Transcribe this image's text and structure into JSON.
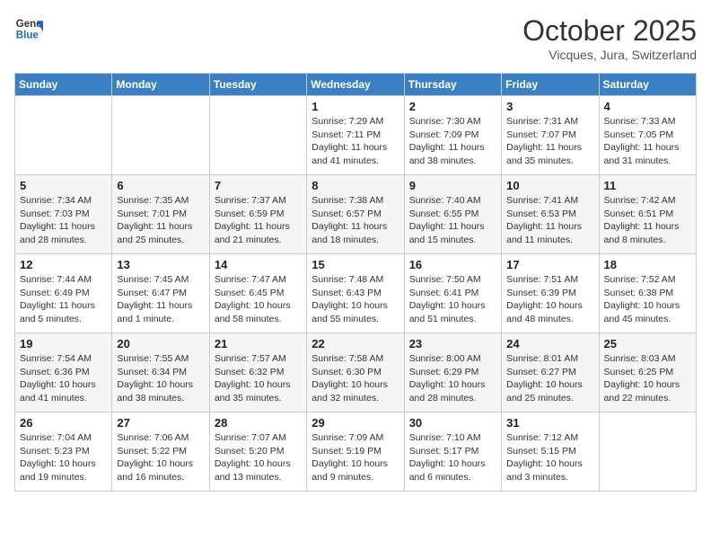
{
  "header": {
    "logo_line1": "General",
    "logo_line2": "Blue",
    "month": "October 2025",
    "location": "Vicques, Jura, Switzerland"
  },
  "weekdays": [
    "Sunday",
    "Monday",
    "Tuesday",
    "Wednesday",
    "Thursday",
    "Friday",
    "Saturday"
  ],
  "weeks": [
    [
      {
        "day": "",
        "info": ""
      },
      {
        "day": "",
        "info": ""
      },
      {
        "day": "",
        "info": ""
      },
      {
        "day": "1",
        "info": "Sunrise: 7:29 AM\nSunset: 7:11 PM\nDaylight: 11 hours\nand 41 minutes."
      },
      {
        "day": "2",
        "info": "Sunrise: 7:30 AM\nSunset: 7:09 PM\nDaylight: 11 hours\nand 38 minutes."
      },
      {
        "day": "3",
        "info": "Sunrise: 7:31 AM\nSunset: 7:07 PM\nDaylight: 11 hours\nand 35 minutes."
      },
      {
        "day": "4",
        "info": "Sunrise: 7:33 AM\nSunset: 7:05 PM\nDaylight: 11 hours\nand 31 minutes."
      }
    ],
    [
      {
        "day": "5",
        "info": "Sunrise: 7:34 AM\nSunset: 7:03 PM\nDaylight: 11 hours\nand 28 minutes."
      },
      {
        "day": "6",
        "info": "Sunrise: 7:35 AM\nSunset: 7:01 PM\nDaylight: 11 hours\nand 25 minutes."
      },
      {
        "day": "7",
        "info": "Sunrise: 7:37 AM\nSunset: 6:59 PM\nDaylight: 11 hours\nand 21 minutes."
      },
      {
        "day": "8",
        "info": "Sunrise: 7:38 AM\nSunset: 6:57 PM\nDaylight: 11 hours\nand 18 minutes."
      },
      {
        "day": "9",
        "info": "Sunrise: 7:40 AM\nSunset: 6:55 PM\nDaylight: 11 hours\nand 15 minutes."
      },
      {
        "day": "10",
        "info": "Sunrise: 7:41 AM\nSunset: 6:53 PM\nDaylight: 11 hours\nand 11 minutes."
      },
      {
        "day": "11",
        "info": "Sunrise: 7:42 AM\nSunset: 6:51 PM\nDaylight: 11 hours\nand 8 minutes."
      }
    ],
    [
      {
        "day": "12",
        "info": "Sunrise: 7:44 AM\nSunset: 6:49 PM\nDaylight: 11 hours\nand 5 minutes."
      },
      {
        "day": "13",
        "info": "Sunrise: 7:45 AM\nSunset: 6:47 PM\nDaylight: 11 hours\nand 1 minute."
      },
      {
        "day": "14",
        "info": "Sunrise: 7:47 AM\nSunset: 6:45 PM\nDaylight: 10 hours\nand 58 minutes."
      },
      {
        "day": "15",
        "info": "Sunrise: 7:48 AM\nSunset: 6:43 PM\nDaylight: 10 hours\nand 55 minutes."
      },
      {
        "day": "16",
        "info": "Sunrise: 7:50 AM\nSunset: 6:41 PM\nDaylight: 10 hours\nand 51 minutes."
      },
      {
        "day": "17",
        "info": "Sunrise: 7:51 AM\nSunset: 6:39 PM\nDaylight: 10 hours\nand 48 minutes."
      },
      {
        "day": "18",
        "info": "Sunrise: 7:52 AM\nSunset: 6:38 PM\nDaylight: 10 hours\nand 45 minutes."
      }
    ],
    [
      {
        "day": "19",
        "info": "Sunrise: 7:54 AM\nSunset: 6:36 PM\nDaylight: 10 hours\nand 41 minutes."
      },
      {
        "day": "20",
        "info": "Sunrise: 7:55 AM\nSunset: 6:34 PM\nDaylight: 10 hours\nand 38 minutes."
      },
      {
        "day": "21",
        "info": "Sunrise: 7:57 AM\nSunset: 6:32 PM\nDaylight: 10 hours\nand 35 minutes."
      },
      {
        "day": "22",
        "info": "Sunrise: 7:58 AM\nSunset: 6:30 PM\nDaylight: 10 hours\nand 32 minutes."
      },
      {
        "day": "23",
        "info": "Sunrise: 8:00 AM\nSunset: 6:29 PM\nDaylight: 10 hours\nand 28 minutes."
      },
      {
        "day": "24",
        "info": "Sunrise: 8:01 AM\nSunset: 6:27 PM\nDaylight: 10 hours\nand 25 minutes."
      },
      {
        "day": "25",
        "info": "Sunrise: 8:03 AM\nSunset: 6:25 PM\nDaylight: 10 hours\nand 22 minutes."
      }
    ],
    [
      {
        "day": "26",
        "info": "Sunrise: 7:04 AM\nSunset: 5:23 PM\nDaylight: 10 hours\nand 19 minutes."
      },
      {
        "day": "27",
        "info": "Sunrise: 7:06 AM\nSunset: 5:22 PM\nDaylight: 10 hours\nand 16 minutes."
      },
      {
        "day": "28",
        "info": "Sunrise: 7:07 AM\nSunset: 5:20 PM\nDaylight: 10 hours\nand 13 minutes."
      },
      {
        "day": "29",
        "info": "Sunrise: 7:09 AM\nSunset: 5:19 PM\nDaylight: 10 hours\nand 9 minutes."
      },
      {
        "day": "30",
        "info": "Sunrise: 7:10 AM\nSunset: 5:17 PM\nDaylight: 10 hours\nand 6 minutes."
      },
      {
        "day": "31",
        "info": "Sunrise: 7:12 AM\nSunset: 5:15 PM\nDaylight: 10 hours\nand 3 minutes."
      },
      {
        "day": "",
        "info": ""
      }
    ]
  ]
}
